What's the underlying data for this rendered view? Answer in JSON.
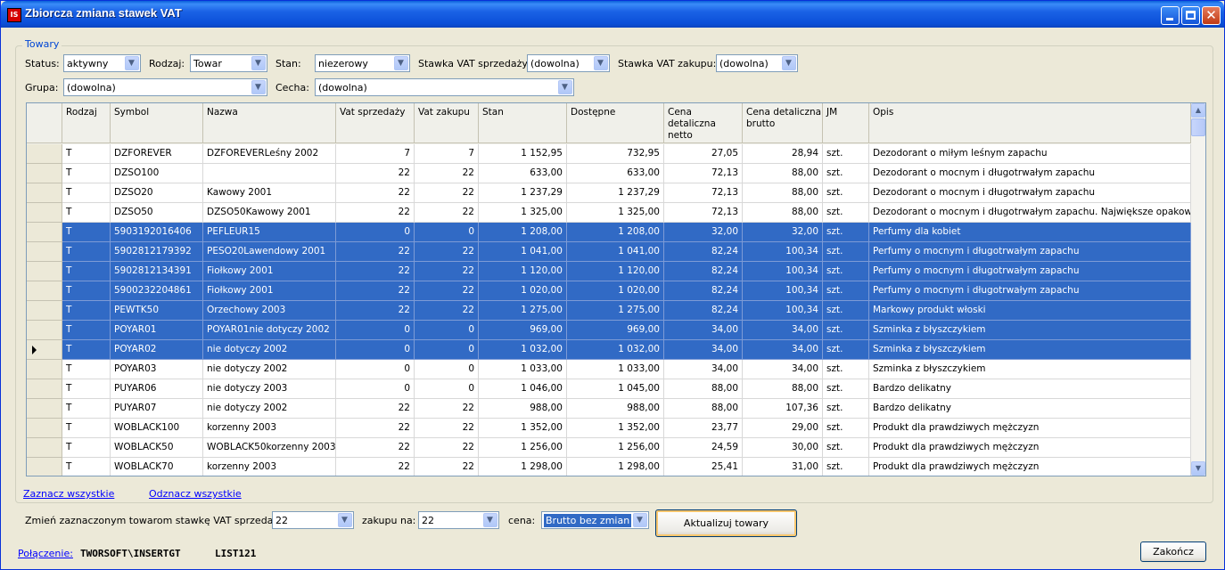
{
  "window": {
    "title": "Zbiorcza zmiana stawek VAT",
    "icon": "app-icon"
  },
  "group": {
    "title": "Towary"
  },
  "filters": {
    "status_label": "Status:",
    "status_value": "aktywny",
    "rodzaj_label": "Rodzaj:",
    "rodzaj_value": "Towar",
    "stan_label": "Stan:",
    "stan_value": "niezerowy",
    "vat_sprz_label": "Stawka VAT sprzedaży:",
    "vat_sprz_value": "(dowolna)",
    "vat_zak_label": "Stawka VAT zakupu:",
    "vat_zak_value": "(dowolna)",
    "grupa_label": "Grupa:",
    "grupa_value": "(dowolna)",
    "cecha_label": "Cecha:",
    "cecha_value": "(dowolna)"
  },
  "grid": {
    "columns": [
      "Rodzaj",
      "Symbol",
      "Nazwa",
      "Vat sprzedaży",
      "Vat zakupu",
      "Stan",
      "Dostępne",
      "Cena detaliczna netto",
      "Cena detaliczna brutto",
      "JM",
      "Opis"
    ],
    "rows": [
      {
        "rodzaj": "T",
        "symbol": "DZFOREVER",
        "nazwa": "DZFOREVERLeśny 2002",
        "vat_s": "7",
        "vat_z": "7",
        "stan": "1 152,95",
        "dostepne": "732,95",
        "netto": "27,05",
        "brutto": "28,94",
        "jm": "szt.",
        "opis": "Dezodorant o miłym leśnym zapachu",
        "selected": false,
        "current": false
      },
      {
        "rodzaj": "T",
        "symbol": "DZSO100",
        "nazwa": "",
        "vat_s": "22",
        "vat_z": "22",
        "stan": "633,00",
        "dostepne": "633,00",
        "netto": "72,13",
        "brutto": "88,00",
        "jm": "szt.",
        "opis": "Dezodorant o mocnym i długotrwałym zapachu",
        "selected": false,
        "current": false
      },
      {
        "rodzaj": "T",
        "symbol": "DZSO20",
        "nazwa": "Kawowy 2001",
        "vat_s": "22",
        "vat_z": "22",
        "stan": "1 237,29",
        "dostepne": "1 237,29",
        "netto": "72,13",
        "brutto": "88,00",
        "jm": "szt.",
        "opis": "Dezodorant o mocnym i długotrwałym zapachu",
        "selected": false,
        "current": false
      },
      {
        "rodzaj": "T",
        "symbol": "DZSO50",
        "nazwa": "DZSO50Kawowy 2001",
        "vat_s": "22",
        "vat_z": "22",
        "stan": "1 325,00",
        "dostepne": "1 325,00",
        "netto": "72,13",
        "brutto": "88,00",
        "jm": "szt.",
        "opis": "Dezodorant o mocnym i długotrwałym zapachu. Największe opakowanie",
        "selected": false,
        "current": false
      },
      {
        "rodzaj": "T",
        "symbol": "5903192016406",
        "nazwa": "PEFLEUR15",
        "vat_s": "0",
        "vat_z": "0",
        "stan": "1 208,00",
        "dostepne": "1 208,00",
        "netto": "32,00",
        "brutto": "32,00",
        "jm": "szt.",
        "opis": "Perfumy dla kobiet",
        "selected": true,
        "current": false
      },
      {
        "rodzaj": "T",
        "symbol": "5902812179392",
        "nazwa": "PESO20Lawendowy 2001",
        "vat_s": "22",
        "vat_z": "22",
        "stan": "1 041,00",
        "dostepne": "1 041,00",
        "netto": "82,24",
        "brutto": "100,34",
        "jm": "szt.",
        "opis": "Perfumy o mocnym i długotrwałym zapachu",
        "selected": true,
        "current": false
      },
      {
        "rodzaj": "T",
        "symbol": "5902812134391",
        "nazwa": "Fiołkowy 2001",
        "vat_s": "22",
        "vat_z": "22",
        "stan": "1 120,00",
        "dostepne": "1 120,00",
        "netto": "82,24",
        "brutto": "100,34",
        "jm": "szt.",
        "opis": "Perfumy o mocnym i długotrwałym zapachu",
        "selected": true,
        "current": false
      },
      {
        "rodzaj": "T",
        "symbol": "5900232204861",
        "nazwa": "Fiołkowy 2001",
        "vat_s": "22",
        "vat_z": "22",
        "stan": "1 020,00",
        "dostepne": "1 020,00",
        "netto": "82,24",
        "brutto": "100,34",
        "jm": "szt.",
        "opis": "Perfumy o mocnym i długotrwałym zapachu",
        "selected": true,
        "current": false
      },
      {
        "rodzaj": "T",
        "symbol": "PEWTK50",
        "nazwa": "Orzechowy 2003",
        "vat_s": "22",
        "vat_z": "22",
        "stan": "1 275,00",
        "dostepne": "1 275,00",
        "netto": "82,24",
        "brutto": "100,34",
        "jm": "szt.",
        "opis": "Markowy produkt włoski",
        "selected": true,
        "current": false
      },
      {
        "rodzaj": "T",
        "symbol": "POYAR01",
        "nazwa": "POYAR01nie dotyczy 2002",
        "vat_s": "0",
        "vat_z": "0",
        "stan": "969,00",
        "dostepne": "969,00",
        "netto": "34,00",
        "brutto": "34,00",
        "jm": "szt.",
        "opis": "Szminka z błyszczykiem",
        "selected": true,
        "current": false
      },
      {
        "rodzaj": "T",
        "symbol": "POYAR02",
        "nazwa": "nie dotyczy 2002",
        "vat_s": "0",
        "vat_z": "0",
        "stan": "1 032,00",
        "dostepne": "1 032,00",
        "netto": "34,00",
        "brutto": "34,00",
        "jm": "szt.",
        "opis": "Szminka z błyszczykiem",
        "selected": true,
        "current": true
      },
      {
        "rodzaj": "T",
        "symbol": "POYAR03",
        "nazwa": "nie dotyczy 2002",
        "vat_s": "0",
        "vat_z": "0",
        "stan": "1 033,00",
        "dostepne": "1 033,00",
        "netto": "34,00",
        "brutto": "34,00",
        "jm": "szt.",
        "opis": "Szminka z błyszczykiem",
        "selected": false,
        "current": false
      },
      {
        "rodzaj": "T",
        "symbol": "PUYAR06",
        "nazwa": "nie dotyczy 2003",
        "vat_s": "0",
        "vat_z": "0",
        "stan": "1 046,00",
        "dostepne": "1 045,00",
        "netto": "88,00",
        "brutto": "88,00",
        "jm": "szt.",
        "opis": "Bardzo delikatny",
        "selected": false,
        "current": false
      },
      {
        "rodzaj": "T",
        "symbol": "PUYAR07",
        "nazwa": "nie dotyczy 2002",
        "vat_s": "22",
        "vat_z": "22",
        "stan": "988,00",
        "dostepne": "988,00",
        "netto": "88,00",
        "brutto": "107,36",
        "jm": "szt.",
        "opis": "Bardzo delikatny",
        "selected": false,
        "current": false
      },
      {
        "rodzaj": "T",
        "symbol": "WOBLACK100",
        "nazwa": "korzenny 2003",
        "vat_s": "22",
        "vat_z": "22",
        "stan": "1 352,00",
        "dostepne": "1 352,00",
        "netto": "23,77",
        "brutto": "29,00",
        "jm": "szt.",
        "opis": "Produkt dla prawdziwych mężczyzn",
        "selected": false,
        "current": false
      },
      {
        "rodzaj": "T",
        "symbol": "WOBLACK50",
        "nazwa": "WOBLACK50korzenny 2003",
        "vat_s": "22",
        "vat_z": "22",
        "stan": "1 256,00",
        "dostepne": "1 256,00",
        "netto": "24,59",
        "brutto": "30,00",
        "jm": "szt.",
        "opis": "Produkt dla prawdziwych mężczyzn",
        "selected": false,
        "current": false
      },
      {
        "rodzaj": "T",
        "symbol": "WOBLACK70",
        "nazwa": "korzenny 2003",
        "vat_s": "22",
        "vat_z": "22",
        "stan": "1 298,00",
        "dostepne": "1 298,00",
        "netto": "25,41",
        "brutto": "31,00",
        "jm": "szt.",
        "opis": "Produkt dla prawdziwych mężczyzn",
        "selected": false,
        "current": false
      }
    ]
  },
  "links": {
    "select_all": "Zaznacz wszystkie",
    "deselect_all": "Odznacz wszystkie"
  },
  "change": {
    "label": "Zmień zaznaczonym towarom stawkę VAT sprzedaży na:",
    "sprz_value": "22",
    "zakup_label": "zakupu na:",
    "zakup_value": "22",
    "cena_label": "cena:",
    "cena_value": "Brutto bez zmian",
    "update_button": "Aktualizuj towary"
  },
  "footer": {
    "connection_label": "Połączenie:",
    "server": "TWORSOFT\\INSERTGT",
    "database": "LIST121",
    "close_button": "Zakończ"
  }
}
